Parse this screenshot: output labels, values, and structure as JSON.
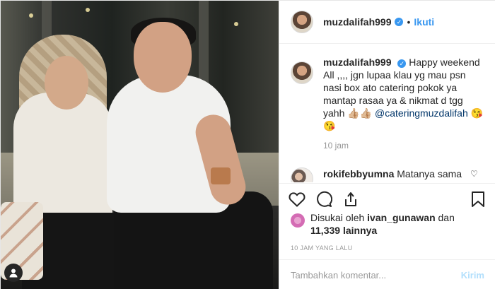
{
  "post": {
    "owner": {
      "username": "muzdalifah999",
      "verified_icon": "verified-badge-icon",
      "follow_label": "Ikuti",
      "separator": "•"
    },
    "caption": {
      "username": "muzdalifah999",
      "text": "Happy weekend All ,,,, jgn lupaa klau yg mau psn nasi box ato catering pokok ya mantap rasaa ya & nikmat d tgg yahh 👍🏼👍🏼",
      "mention": "@cateringmuzdalifah",
      "emoji": "😘😘",
      "time": "10 jam"
    },
    "comments": [
      {
        "username": "rokifebbyumna",
        "text": "Matanya sama .. semoga jodoh smpai akhir hayat"
      }
    ],
    "actions": {
      "like_icon": "heart-icon",
      "comment_icon": "comment-icon",
      "share_icon": "share-icon",
      "save_icon": "bookmark-icon"
    },
    "likes": {
      "prefix": "Disukai oleh",
      "user": "ivan_gunawan",
      "and": "dan",
      "count": "11,339",
      "suffix": "lainnya"
    },
    "posted_ago": "10 JAM YANG LALU",
    "composer": {
      "placeholder": "Tambahkan komentar...",
      "send_label": "Kirim"
    }
  }
}
